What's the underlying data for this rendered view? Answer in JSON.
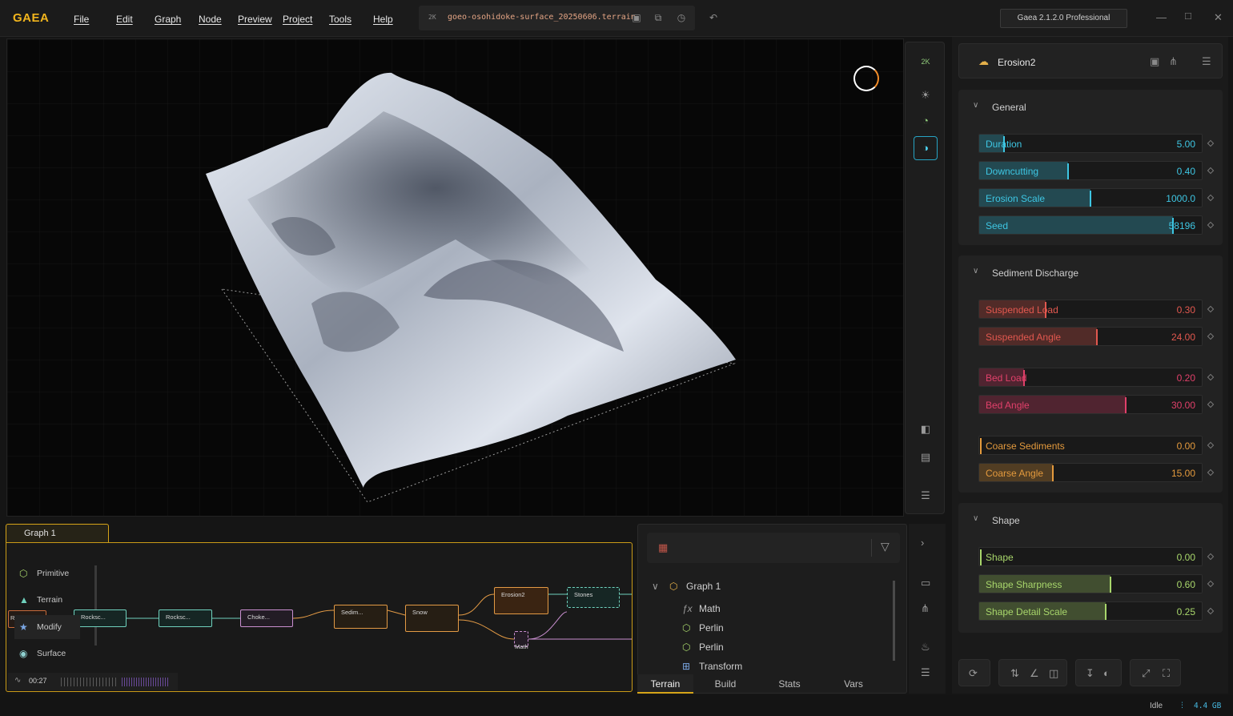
{
  "app": {
    "logo": "GAEA",
    "menu": [
      "File",
      "Edit",
      "Graph",
      "Node",
      "Preview",
      "Project",
      "Tools",
      "Help"
    ],
    "file_chip": "2K",
    "filename": "goeo-osohidoke-surface_20250606.terrain",
    "version": "Gaea 2.1.2.0 Professional"
  },
  "viewport": {
    "resolution_chip": "2K",
    "loading_indicator": "spinner"
  },
  "node": {
    "name": "Erosion2",
    "icon": "cloud-icon"
  },
  "sections": [
    {
      "title": "General",
      "params": [
        {
          "label": "Duration",
          "value": "5.00",
          "fraction": 0.11,
          "color": "#3ec6e3"
        },
        {
          "label": "Downcutting",
          "value": "0.40",
          "fraction": 0.4,
          "color": "#3ec6e3"
        },
        {
          "label": "Erosion Scale",
          "value": "1000.0",
          "fraction": 0.5,
          "color": "#3ec6e3"
        },
        {
          "label": "Seed",
          "value": "58196",
          "fraction": 0.87,
          "color": "#3ec6e3"
        }
      ]
    },
    {
      "title": "Sediment Discharge",
      "params": [
        {
          "label": "Suspended Load",
          "value": "0.30",
          "fraction": 0.3,
          "color": "#e2584f"
        },
        {
          "label": "Suspended Angle",
          "value": "24.00",
          "fraction": 0.53,
          "color": "#e2584f"
        },
        {
          "label": "Bed Load",
          "value": "0.20",
          "fraction": 0.2,
          "color": "#e0406a"
        },
        {
          "label": "Bed Angle",
          "value": "30.00",
          "fraction": 0.66,
          "color": "#e0406a"
        },
        {
          "label": "Coarse Sediments",
          "value": "0.00",
          "fraction": 0.0,
          "color": "#e49a3d"
        },
        {
          "label": "Coarse Angle",
          "value": "15.00",
          "fraction": 0.33,
          "color": "#e49a3d"
        }
      ]
    },
    {
      "title": "Shape",
      "params": [
        {
          "label": "Shape",
          "value": "0.00",
          "fraction": 0.0,
          "color": "#a8d66b"
        },
        {
          "label": "Shape Sharpness",
          "value": "0.60",
          "fraction": 0.59,
          "color": "#a8d66b"
        },
        {
          "label": "Shape Detail Scale",
          "value": "0.25",
          "fraction": 0.57,
          "color": "#a8d66b"
        }
      ]
    }
  ],
  "graph": {
    "tab": "Graph 1",
    "palette": [
      {
        "label": "Primitive",
        "icon": "cube-icon"
      },
      {
        "label": "Terrain",
        "icon": "mountain-icon"
      },
      {
        "label": "Modify",
        "icon": "modify-icon"
      },
      {
        "label": "Surface",
        "icon": "surface-icon"
      }
    ],
    "timer": "00:27",
    "nodes": [
      {
        "label": "Ro...",
        "color": "#c86a3a"
      },
      {
        "label": "Rocksc...",
        "color": "#6fd1bd"
      },
      {
        "label": "Rocksc...",
        "color": "#6fd1bd"
      },
      {
        "label": "Choke...",
        "color": "#c98fd0"
      },
      {
        "label": "Sedim...",
        "color": "#e39a45"
      },
      {
        "label": "Snow",
        "color": "#e39a45"
      },
      {
        "label": "Erosion2",
        "color": "#e39a45"
      },
      {
        "label": "Stones",
        "color": "#6fd1bd"
      },
      {
        "label": "Math",
        "color": "#c98fd0"
      }
    ]
  },
  "explorer": {
    "root": "Graph 1",
    "items": [
      {
        "label": "Math",
        "icon": "fx-icon"
      },
      {
        "label": "Perlin",
        "icon": "hexagon-icon"
      },
      {
        "label": "Perlin",
        "icon": "hexagon-icon"
      },
      {
        "label": "Transform",
        "icon": "transform-icon"
      }
    ],
    "tabs": [
      "Terrain",
      "Build",
      "Stats",
      "Vars"
    ],
    "active_tab": "Terrain"
  },
  "status": {
    "state": "Idle",
    "memory": "4.4 GB"
  }
}
